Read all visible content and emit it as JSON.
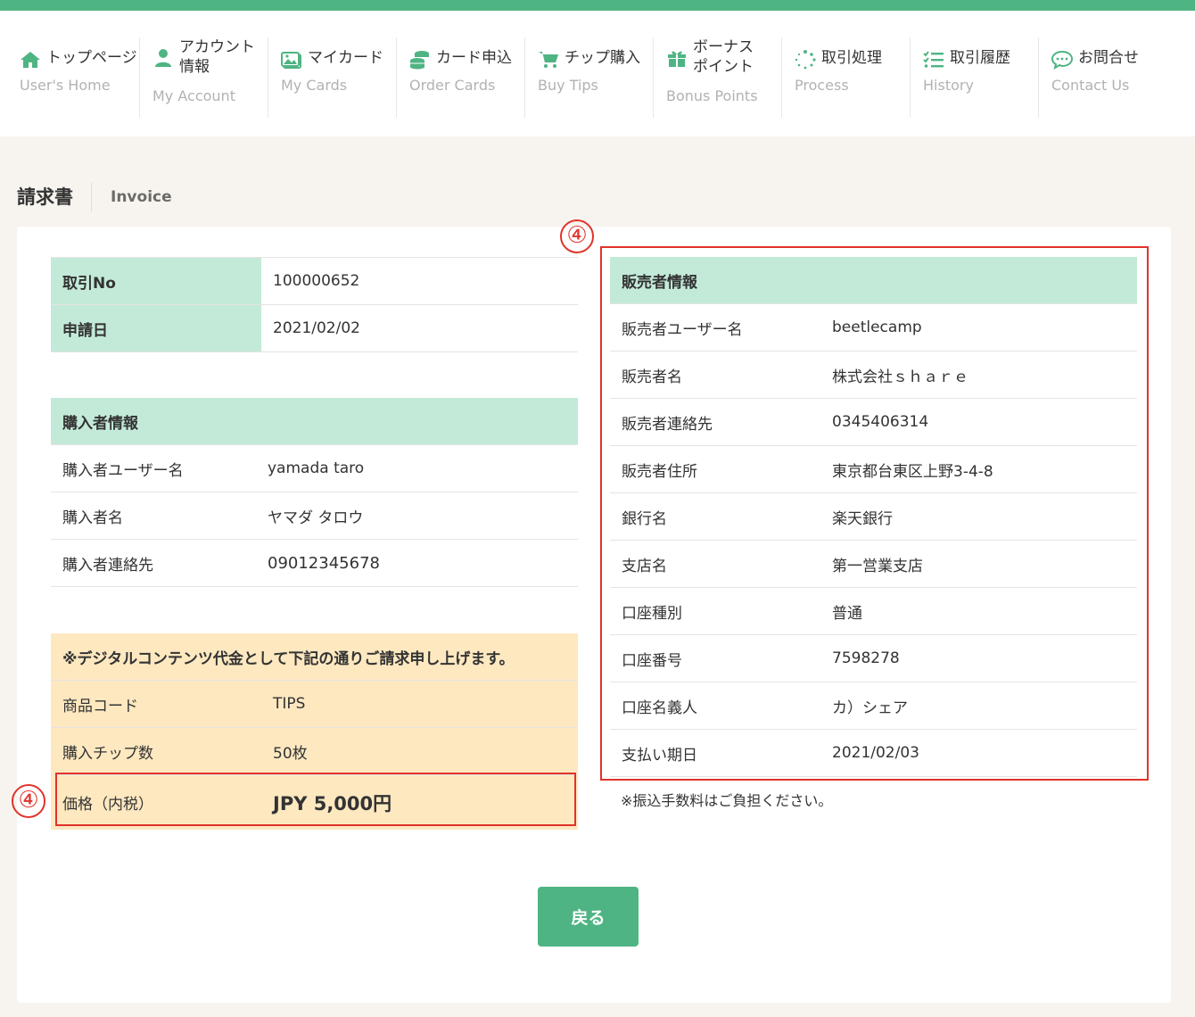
{
  "nav": [
    {
      "jp": "トップページ",
      "en": "User's Home",
      "icon": "home-icon"
    },
    {
      "jp1": "アカウント",
      "jp2": "情報",
      "en": "My Account",
      "icon": "user-icon"
    },
    {
      "jp": "マイカード",
      "en": "My Cards",
      "icon": "image-icon"
    },
    {
      "jp": "カード申込",
      "en": "Order Cards",
      "icon": "coins-icon"
    },
    {
      "jp": "チップ購入",
      "en": "Buy Tips",
      "icon": "cart-icon"
    },
    {
      "jp1": "ボーナス",
      "jp2": "ポイント",
      "en": "Bonus Points",
      "icon": "gift-icon"
    },
    {
      "jp": "取引処理",
      "en": "Process",
      "icon": "spinner-icon"
    },
    {
      "jp": "取引履歴",
      "en": "History",
      "icon": "list-check-icon"
    },
    {
      "jp": "お問合せ",
      "en": "Contact Us",
      "icon": "chat-icon"
    }
  ],
  "page": {
    "title_jp": "請求書",
    "title_en": "Invoice"
  },
  "transaction": {
    "no_label": "取引No",
    "no_value": "100000652",
    "date_label": "申請日",
    "date_value": "2021/02/02"
  },
  "buyer": {
    "header": "購入者情報",
    "rows": [
      {
        "label": "購入者ユーザー名",
        "value": "yamada taro"
      },
      {
        "label": "購入者名",
        "value": "ヤマダ タロウ"
      },
      {
        "label": "購入者連絡先",
        "value": "09012345678"
      }
    ]
  },
  "billing": {
    "header": "※デジタルコンテンツ代金として下記の通りご請求申し上げます。",
    "rows": [
      {
        "label": "商品コード",
        "value": "TIPS"
      },
      {
        "label": "購入チップ数",
        "value": "50枚"
      }
    ],
    "price_label": "価格（内税）",
    "price_value": "JPY 5,000円"
  },
  "seller": {
    "header": "販売者情報",
    "rows": [
      {
        "label": "販売者ユーザー名",
        "value": "beetlecamp"
      },
      {
        "label": "販売者名",
        "value": "株式会社ｓｈａｒｅ"
      },
      {
        "label": "販売者連絡先",
        "value": "0345406314"
      },
      {
        "label": "販売者住所",
        "value": "東京都台東区上野3-4-8"
      },
      {
        "label": "銀行名",
        "value": "楽天銀行"
      },
      {
        "label": "支店名",
        "value": "第一営業支店"
      },
      {
        "label": "口座種別",
        "value": "普通"
      },
      {
        "label": "口座番号",
        "value": "7598278"
      },
      {
        "label": "口座名義人",
        "value": "カ）シェア"
      },
      {
        "label": "支払い期日",
        "value": "2021/02/03"
      }
    ],
    "note": "※振込手数料はご負担ください。"
  },
  "markers": {
    "m1": "④",
    "m2": "④"
  },
  "back_button": "戻る",
  "colors": {
    "brand": "#4fb483",
    "table_header": "#c3ead9",
    "billing_bg": "#fde8c0",
    "annotation": "#e0332b"
  }
}
